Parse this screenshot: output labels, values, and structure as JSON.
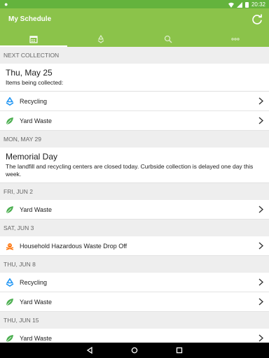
{
  "status_bar": {
    "time": "20:32"
  },
  "app_bar": {
    "title": "My Schedule"
  },
  "tabs": [
    {
      "name": "calendar-icon",
      "active": true
    },
    {
      "name": "recycle-icon",
      "active": false
    },
    {
      "name": "search-icon",
      "active": false
    },
    {
      "name": "more-icon",
      "active": false
    }
  ],
  "sections": {
    "next_collection": {
      "header": "NEXT COLLECTION",
      "date": "Thu, May 25",
      "subtitle": "Items being collected:",
      "items": [
        {
          "label": "Recycling",
          "icon": "recycle-icon"
        },
        {
          "label": "Yard Waste",
          "icon": "leaf-icon"
        }
      ]
    },
    "may29": {
      "header": "MON, MAY 29",
      "title": "Memorial Day",
      "text": "The landfill and recycling centers are closed today. Curbside collection is delayed one day this week."
    },
    "jun2": {
      "header": "FRI, JUN 2",
      "items": [
        {
          "label": "Yard Waste",
          "icon": "leaf-icon"
        }
      ]
    },
    "jun3": {
      "header": "SAT, JUN 3",
      "items": [
        {
          "label": "Household Hazardous Waste Drop Off",
          "icon": "hazard-icon"
        }
      ]
    },
    "jun8": {
      "header": "THU, JUN 8",
      "items": [
        {
          "label": "Recycling",
          "icon": "recycle-icon"
        },
        {
          "label": "Yard Waste",
          "icon": "leaf-icon"
        }
      ]
    },
    "jun15": {
      "header": "THU, JUN 15",
      "items": [
        {
          "label": "Yard Waste",
          "icon": "leaf-icon"
        }
      ]
    }
  },
  "colors": {
    "primary": "#8bc34a",
    "dark": "#64b33d",
    "recycle": "#2196f3",
    "leaf": "#4caf50",
    "hazard": "#ff6f00"
  }
}
